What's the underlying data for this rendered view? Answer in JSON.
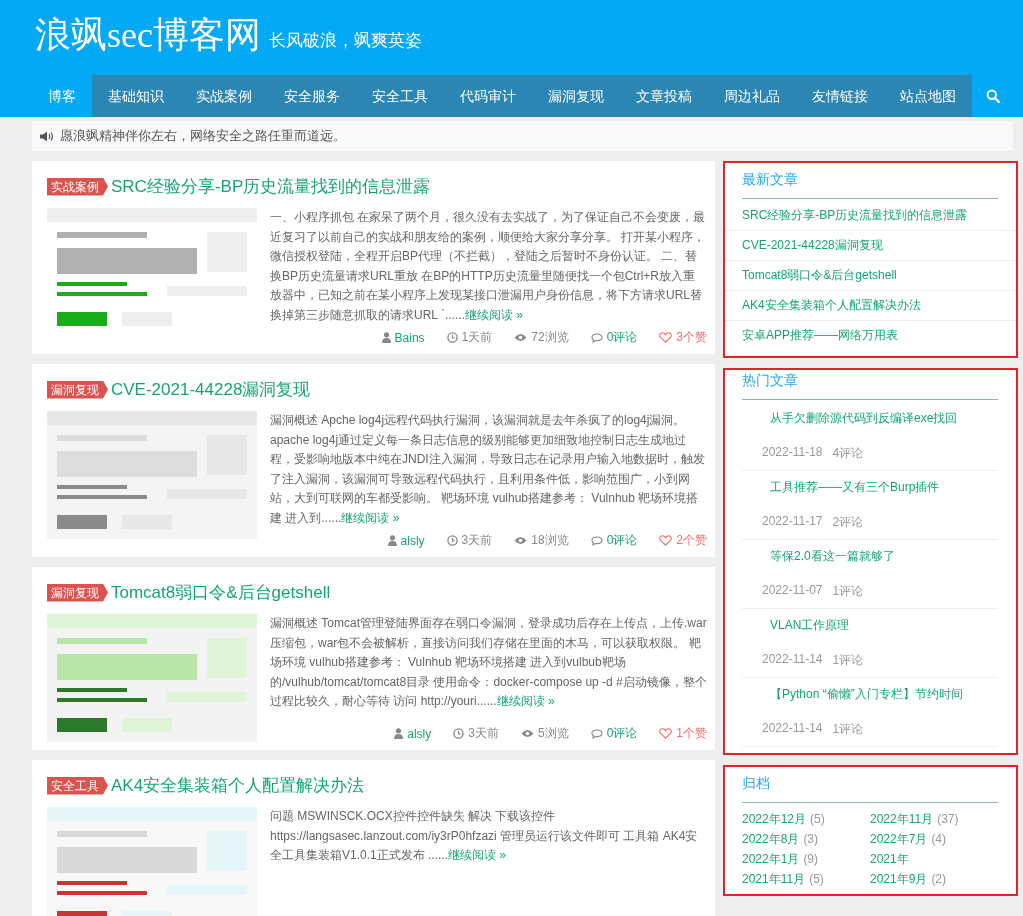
{
  "site": {
    "title": "浪飒sec博客网",
    "slogan": "长风破浪，飒爽英姿"
  },
  "nav": {
    "items": [
      {
        "label": "博客",
        "selected": true
      },
      {
        "label": "基础知识",
        "selected": false
      },
      {
        "label": "实战案例",
        "selected": false
      },
      {
        "label": "安全服务",
        "selected": false
      },
      {
        "label": "安全工具",
        "selected": false
      },
      {
        "label": "代码审计",
        "selected": false
      },
      {
        "label": "漏洞复现",
        "selected": false
      },
      {
        "label": "文章投稿",
        "selected": false
      },
      {
        "label": "周边礼品",
        "selected": false
      },
      {
        "label": "友情链接",
        "selected": false
      },
      {
        "label": "站点地图",
        "selected": false
      }
    ]
  },
  "notice": "愿浪飒精神伴你左右，网络安全之路任重而道远。",
  "posts": [
    {
      "tag": "实战案例",
      "title": "SRC经验分享-BP历史流量找到的信息泄露",
      "excerpt": "一、小程序抓包 在家呆了两个月，很久没有去实战了，为了保证自己不会变废，最近复习了以前自己的实战和朋友给的案例，顺便给大家分享分享。 打开某小程序，微信授权登陆，全程开启BP代理（不拦截），登陆之后暂时不身份认证。 二、替换BP历史流量请求URL重放 在BP的HTTP历史流量里随便找一个包Ctrl+R放入重放器中，已知之前在某小程序上发现某接口泄漏用户身份信息，将下方请求URL替换掉第三步随意抓取的请求URL `......",
      "more": "继续阅读 »",
      "meta": {
        "author": "Bains",
        "time": "1天前",
        "views": "72浏览",
        "comments": "0评论",
        "likes": "3个赞"
      }
    },
    {
      "tag": "漏洞复现",
      "title": "CVE-2021-44228漏洞复现",
      "excerpt": "漏洞概述 Apche log4j远程代码执行漏洞，该漏洞就是去年杀疯了的log4j漏洞。 apache log4j通过定义每一条日志信息的级别能够更加细致地控制日志生成地过程，受影响地版本中纯在JNDI注入漏洞，导致日志在记录用户输入地数据时，触发了注入漏洞，该漏洞可导致远程代码执行，且利用条件低，影响范围广，小到网站，大到可联网的车都受影响。 靶场环境 vulhub搭建参考： Vulnhub 靶场环境搭建 进入到......",
      "more": "继续阅读 »",
      "meta": {
        "author": "alsly",
        "time": "3天前",
        "views": "18浏览",
        "comments": "0评论",
        "likes": "2个赞"
      }
    },
    {
      "tag": "漏洞复现",
      "title": "Tomcat8弱口令&后台getshell",
      "excerpt": "漏洞概述 Tomcat管理登陆界面存在弱口令漏洞，登录成功后存在上传点，上传.war压缩包，war包不会被解析，直接访问我们存储在里面的木马，可以获取权限。 靶场环境 vulhub搭建参考： Vulnhub 靶场环境搭建 进入到vulbub靶场的/vulhub/tomcat/tomcat8目录 使用命令：docker-compose up -d #启动镜像，整个过程比较久，耐心等待 访问 http://youri......",
      "more": "继续阅读 »",
      "meta": {
        "author": "alsly",
        "time": "3天前",
        "views": "5浏览",
        "comments": "0评论",
        "likes": "1个赞"
      }
    },
    {
      "tag": "安全工具",
      "title": "AK4安全集装箱个人配置解决办法",
      "excerpt": "问题 MSWINSCK.OCX控件控件缺失 解决 下载该控件 https://langsasec.lanzout.com/iy3rP0hfzazi 管理员运行该文件即可 工具箱 AK4安全工具集装箱V1.0.1正式发布 ......",
      "more": "继续阅读 »"
    }
  ],
  "sidebar": [
    {
      "kind": "latest",
      "title": "最新文章",
      "highlighted": true,
      "items": [
        {
          "title": "SRC经验分享-BP历史流量找到的信息泄露"
        },
        {
          "title": "CVE-2021-44228漏洞复现"
        },
        {
          "title": "Tomcat8弱口令&后台getshell"
        },
        {
          "title": "AK4安全集装箱个人配置解决办法"
        },
        {
          "title": "安卓APP推荐——网络万用表"
        }
      ]
    },
    {
      "kind": "hot",
      "title": "热门文章",
      "highlighted": true,
      "items": [
        {
          "title": "从手欠删除源代码到反编译exe找回",
          "date": "2022-11-18",
          "comments": "4评论"
        },
        {
          "title": "工具推荐——又有三个Burp插件",
          "date": "2022-11-17",
          "comments": "2评论"
        },
        {
          "title": "等保2.0看这一篇就够了",
          "date": "2022-11-07",
          "comments": "1评论"
        },
        {
          "title": "VLAN工作原理",
          "date": "2022-11-14",
          "comments": "1评论"
        },
        {
          "title": "【Python “偷懒”入门专栏】节约时间",
          "date": "2022-11-14",
          "comments": "1评论"
        }
      ]
    },
    {
      "kind": "archive",
      "title": "归档",
      "highlighted": true,
      "items": [
        {
          "month": "2022年12月",
          "count": "(5)"
        },
        {
          "month": "2022年11月",
          "count": "(37)"
        },
        {
          "month": "2022年8月",
          "count": "(3)"
        },
        {
          "month": "2022年7月",
          "count": "(4)"
        },
        {
          "month": "2022年1月",
          "count": "(9)"
        },
        {
          "month": "2021年"
        },
        {
          "month": "2021年11月",
          "count": "(5)"
        },
        {
          "month": "2021年9月",
          "count": "(2)"
        }
      ]
    }
  ]
}
